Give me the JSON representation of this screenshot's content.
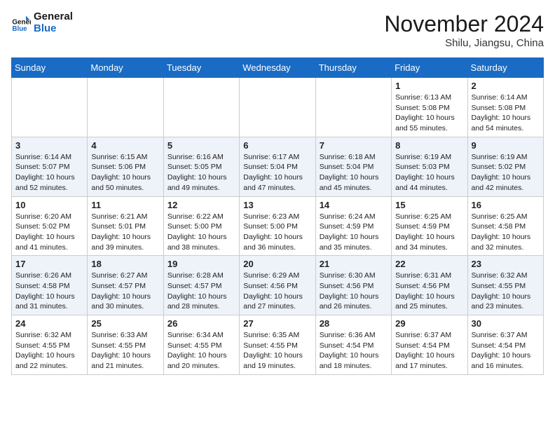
{
  "logo": {
    "line1": "General",
    "line2": "Blue"
  },
  "title": "November 2024",
  "location": "Shilu, Jiangsu, China",
  "days_of_week": [
    "Sunday",
    "Monday",
    "Tuesday",
    "Wednesday",
    "Thursday",
    "Friday",
    "Saturday"
  ],
  "weeks": [
    [
      {
        "day": null,
        "info": null
      },
      {
        "day": null,
        "info": null
      },
      {
        "day": null,
        "info": null
      },
      {
        "day": null,
        "info": null
      },
      {
        "day": null,
        "info": null
      },
      {
        "day": "1",
        "info": "Sunrise: 6:13 AM\nSunset: 5:08 PM\nDaylight: 10 hours\nand 55 minutes."
      },
      {
        "day": "2",
        "info": "Sunrise: 6:14 AM\nSunset: 5:08 PM\nDaylight: 10 hours\nand 54 minutes."
      }
    ],
    [
      {
        "day": "3",
        "info": "Sunrise: 6:14 AM\nSunset: 5:07 PM\nDaylight: 10 hours\nand 52 minutes."
      },
      {
        "day": "4",
        "info": "Sunrise: 6:15 AM\nSunset: 5:06 PM\nDaylight: 10 hours\nand 50 minutes."
      },
      {
        "day": "5",
        "info": "Sunrise: 6:16 AM\nSunset: 5:05 PM\nDaylight: 10 hours\nand 49 minutes."
      },
      {
        "day": "6",
        "info": "Sunrise: 6:17 AM\nSunset: 5:04 PM\nDaylight: 10 hours\nand 47 minutes."
      },
      {
        "day": "7",
        "info": "Sunrise: 6:18 AM\nSunset: 5:04 PM\nDaylight: 10 hours\nand 45 minutes."
      },
      {
        "day": "8",
        "info": "Sunrise: 6:19 AM\nSunset: 5:03 PM\nDaylight: 10 hours\nand 44 minutes."
      },
      {
        "day": "9",
        "info": "Sunrise: 6:19 AM\nSunset: 5:02 PM\nDaylight: 10 hours\nand 42 minutes."
      }
    ],
    [
      {
        "day": "10",
        "info": "Sunrise: 6:20 AM\nSunset: 5:02 PM\nDaylight: 10 hours\nand 41 minutes."
      },
      {
        "day": "11",
        "info": "Sunrise: 6:21 AM\nSunset: 5:01 PM\nDaylight: 10 hours\nand 39 minutes."
      },
      {
        "day": "12",
        "info": "Sunrise: 6:22 AM\nSunset: 5:00 PM\nDaylight: 10 hours\nand 38 minutes."
      },
      {
        "day": "13",
        "info": "Sunrise: 6:23 AM\nSunset: 5:00 PM\nDaylight: 10 hours\nand 36 minutes."
      },
      {
        "day": "14",
        "info": "Sunrise: 6:24 AM\nSunset: 4:59 PM\nDaylight: 10 hours\nand 35 minutes."
      },
      {
        "day": "15",
        "info": "Sunrise: 6:25 AM\nSunset: 4:59 PM\nDaylight: 10 hours\nand 34 minutes."
      },
      {
        "day": "16",
        "info": "Sunrise: 6:25 AM\nSunset: 4:58 PM\nDaylight: 10 hours\nand 32 minutes."
      }
    ],
    [
      {
        "day": "17",
        "info": "Sunrise: 6:26 AM\nSunset: 4:58 PM\nDaylight: 10 hours\nand 31 minutes."
      },
      {
        "day": "18",
        "info": "Sunrise: 6:27 AM\nSunset: 4:57 PM\nDaylight: 10 hours\nand 30 minutes."
      },
      {
        "day": "19",
        "info": "Sunrise: 6:28 AM\nSunset: 4:57 PM\nDaylight: 10 hours\nand 28 minutes."
      },
      {
        "day": "20",
        "info": "Sunrise: 6:29 AM\nSunset: 4:56 PM\nDaylight: 10 hours\nand 27 minutes."
      },
      {
        "day": "21",
        "info": "Sunrise: 6:30 AM\nSunset: 4:56 PM\nDaylight: 10 hours\nand 26 minutes."
      },
      {
        "day": "22",
        "info": "Sunrise: 6:31 AM\nSunset: 4:56 PM\nDaylight: 10 hours\nand 25 minutes."
      },
      {
        "day": "23",
        "info": "Sunrise: 6:32 AM\nSunset: 4:55 PM\nDaylight: 10 hours\nand 23 minutes."
      }
    ],
    [
      {
        "day": "24",
        "info": "Sunrise: 6:32 AM\nSunset: 4:55 PM\nDaylight: 10 hours\nand 22 minutes."
      },
      {
        "day": "25",
        "info": "Sunrise: 6:33 AM\nSunset: 4:55 PM\nDaylight: 10 hours\nand 21 minutes."
      },
      {
        "day": "26",
        "info": "Sunrise: 6:34 AM\nSunset: 4:55 PM\nDaylight: 10 hours\nand 20 minutes."
      },
      {
        "day": "27",
        "info": "Sunrise: 6:35 AM\nSunset: 4:55 PM\nDaylight: 10 hours\nand 19 minutes."
      },
      {
        "day": "28",
        "info": "Sunrise: 6:36 AM\nSunset: 4:54 PM\nDaylight: 10 hours\nand 18 minutes."
      },
      {
        "day": "29",
        "info": "Sunrise: 6:37 AM\nSunset: 4:54 PM\nDaylight: 10 hours\nand 17 minutes."
      },
      {
        "day": "30",
        "info": "Sunrise: 6:37 AM\nSunset: 4:54 PM\nDaylight: 10 hours\nand 16 minutes."
      }
    ]
  ]
}
